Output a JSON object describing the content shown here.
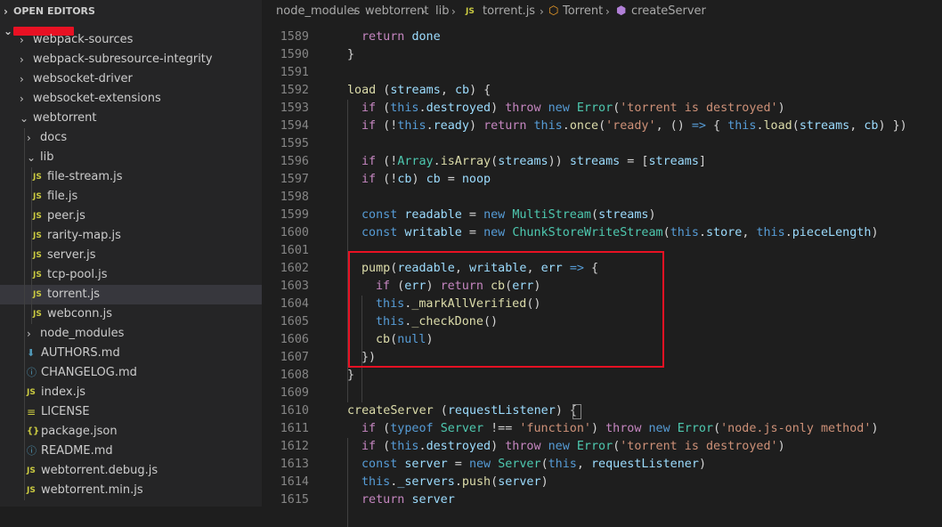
{
  "sidebar": {
    "open_editors_label": "OPEN EDITORS",
    "items": [
      {
        "label": "webpack-sources",
        "type": "folder",
        "state": "collapsed"
      },
      {
        "label": "webpack-subresource-integrity",
        "type": "folder",
        "state": "collapsed"
      },
      {
        "label": "websocket-driver",
        "type": "folder",
        "state": "collapsed"
      },
      {
        "label": "websocket-extensions",
        "type": "folder",
        "state": "collapsed"
      },
      {
        "label": "webtorrent",
        "type": "folder",
        "state": "expanded"
      },
      {
        "label": "docs",
        "type": "folder",
        "state": "collapsed"
      },
      {
        "label": "lib",
        "type": "folder",
        "state": "expanded"
      },
      {
        "label": "file-stream.js",
        "type": "js"
      },
      {
        "label": "file.js",
        "type": "js"
      },
      {
        "label": "peer.js",
        "type": "js"
      },
      {
        "label": "rarity-map.js",
        "type": "js"
      },
      {
        "label": "server.js",
        "type": "js"
      },
      {
        "label": "tcp-pool.js",
        "type": "js"
      },
      {
        "label": "torrent.js",
        "type": "js",
        "active": true
      },
      {
        "label": "webconn.js",
        "type": "js"
      },
      {
        "label": "node_modules",
        "type": "folder",
        "state": "collapsed"
      },
      {
        "label": "AUTHORS.md",
        "type": "download"
      },
      {
        "label": "CHANGELOG.md",
        "type": "info"
      },
      {
        "label": "index.js",
        "type": "js"
      },
      {
        "label": "LICENSE",
        "type": "license"
      },
      {
        "label": "package.json",
        "type": "json"
      },
      {
        "label": "README.md",
        "type": "info"
      },
      {
        "label": "webtorrent.debug.js",
        "type": "js"
      },
      {
        "label": "webtorrent.min.js",
        "type": "js"
      }
    ]
  },
  "breadcrumb": {
    "parts": [
      "node_modules",
      "webtorrent",
      "lib",
      "torrent.js",
      "Torrent",
      "createServer"
    ],
    "js_badge": "JS"
  },
  "icons": {
    "js": "JS",
    "json": "{}",
    "folder_chevron_right": "chevron-right-icon",
    "folder_chevron_down": "chevron-down-icon"
  },
  "colors": {
    "highlight_box": "#e81123",
    "keyword": "#569cd6",
    "control": "#c586c0",
    "function": "#dcdcaa",
    "variable": "#9cdcfe",
    "string": "#ce9178",
    "type": "#4ec9b0"
  },
  "code": {
    "lines": [
      {
        "n": "1589"
      },
      {
        "n": "1590"
      },
      {
        "n": "1591"
      },
      {
        "n": "1592"
      },
      {
        "n": "1593"
      },
      {
        "n": "1594"
      },
      {
        "n": "1595"
      },
      {
        "n": "1596"
      },
      {
        "n": "1597"
      },
      {
        "n": "1598"
      },
      {
        "n": "1599"
      },
      {
        "n": "1600"
      },
      {
        "n": "1601"
      },
      {
        "n": "1602"
      },
      {
        "n": "1603"
      },
      {
        "n": "1604"
      },
      {
        "n": "1605"
      },
      {
        "n": "1606"
      },
      {
        "n": "1607"
      },
      {
        "n": "1608"
      },
      {
        "n": "1609"
      },
      {
        "n": "1610"
      },
      {
        "n": "1611"
      },
      {
        "n": "1612"
      },
      {
        "n": "1613"
      },
      {
        "n": "1614"
      },
      {
        "n": "1615"
      }
    ],
    "tokens": {
      "return": "return",
      "done": "done",
      "rbrace": "}",
      "load": "load",
      "if": "if",
      "this": "this",
      "destroyed": "destroyed",
      "throw": "throw",
      "new": "new",
      "Error": "Error",
      "torrent_destroyed": "'torrent is destroyed'",
      "ready": "ready",
      "once": "once",
      "ready_str": "'ready'",
      "arrow": "=>",
      "Array": "Array",
      "isArray": "isArray",
      "streams": "streams",
      "cb": "cb",
      "noop": "noop",
      "const": "const",
      "readable": "readable",
      "writable": "writable",
      "MultiStream": "MultiStream",
      "ChunkStoreWriteStream": "ChunkStoreWriteStream",
      "store": "store",
      "pieceLength": "pieceLength",
      "pump": "pump",
      "err": "err",
      "_markAllVerified": "_markAllVerified",
      "_checkDone": "_checkDone",
      "null": "null",
      "createServer": "createServer",
      "requestListener": "requestListener",
      "typeof": "typeof",
      "Server": "Server",
      "function_str": "'function'",
      "nodejs_only": "'node.js-only method'",
      "server": "server",
      "_servers": "_servers",
      "push": "push"
    }
  }
}
